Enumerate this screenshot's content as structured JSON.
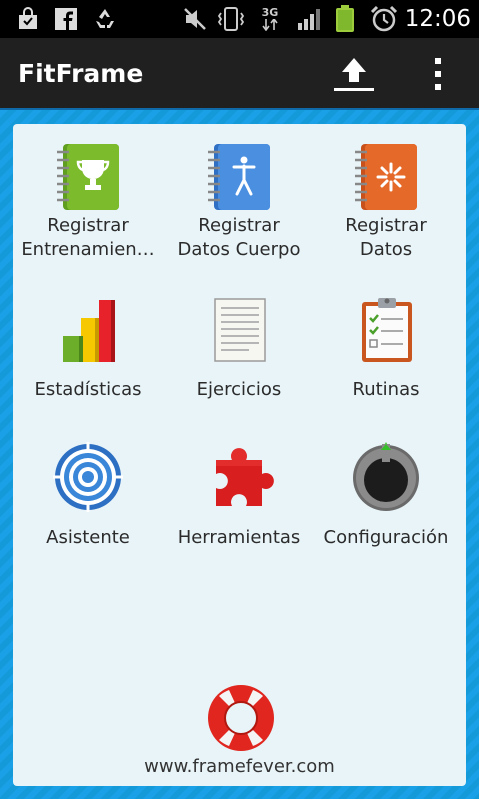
{
  "status_bar": {
    "left_icons": [
      "shopping-bag-icon",
      "facebook-icon",
      "recycle-icon"
    ],
    "right_icons": [
      "mute-icon",
      "vibrate-icon",
      "network-3g-icon",
      "signal-icon",
      "battery-icon",
      "alarm-icon"
    ],
    "network_label": "3G",
    "time": "12:06"
  },
  "action_bar": {
    "title": "FitFrame",
    "upload_icon": "upload-icon",
    "overflow_icon": "overflow-menu-icon"
  },
  "grid": [
    {
      "line1": "Registrar",
      "line2": "Entrenamien…",
      "icon": "trophy-notebook-icon"
    },
    {
      "line1": "Registrar",
      "line2": "Datos Cuerpo",
      "icon": "body-notebook-icon"
    },
    {
      "line1": "Registrar",
      "line2": "Datos",
      "icon": "data-notebook-icon"
    },
    {
      "line1": "Estadísticas",
      "icon": "bar-chart-icon"
    },
    {
      "line1": "Ejercicios",
      "icon": "document-icon"
    },
    {
      "line1": "Rutinas",
      "icon": "clipboard-checklist-icon"
    },
    {
      "line1": "Asistente",
      "icon": "target-icon"
    },
    {
      "line1": "Herramientas",
      "icon": "puzzle-icon"
    },
    {
      "line1": "Configuración",
      "icon": "settings-knob-icon"
    }
  ],
  "footer": {
    "icon": "lifebuoy-icon",
    "link": "www.framefever.com"
  },
  "colors": {
    "accent": "#1a9ae0",
    "panel": "#e8f4f8",
    "actionbar": "#202020"
  }
}
